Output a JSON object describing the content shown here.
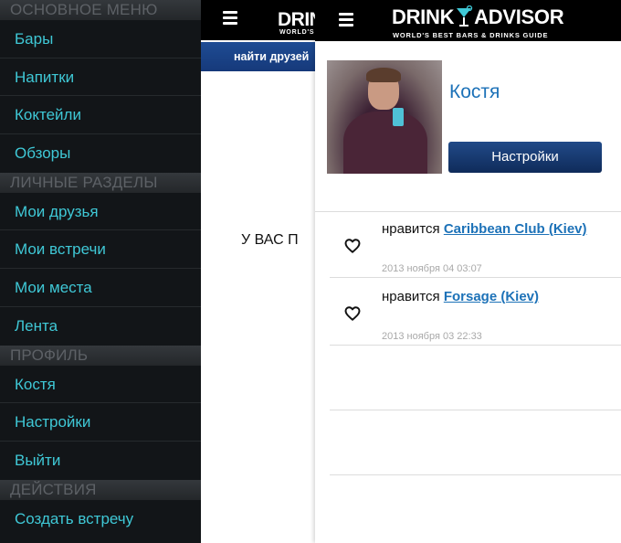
{
  "menu": {
    "sections": [
      {
        "header": "ОСНОВНОЕ МЕНЮ",
        "items": [
          "Бары",
          "Напитки",
          "Коктейли",
          "Обзоры"
        ]
      },
      {
        "header": "ЛИЧНЫЕ РАЗДЕЛЫ",
        "items": [
          "Мои друзья",
          "Мои встречи",
          "Мои места",
          "Лента"
        ]
      },
      {
        "header": "ПРОФИЛЬ",
        "items": [
          "Костя",
          "Настройки",
          "Выйти"
        ]
      },
      {
        "header": "ДЕЙСТВИЯ",
        "items": [
          "Создать встречу"
        ]
      }
    ]
  },
  "background_page": {
    "logo_text": "DRINK",
    "logo_sub": "WORLD'S",
    "tab_label": "найти друзей",
    "message": "У ВАС П"
  },
  "header": {
    "logo_left": "DRINK",
    "logo_right": "ADVISOR",
    "tagline": "WORLD'S BEST BARS & DRINKS GUIDE"
  },
  "profile": {
    "name": "Костя",
    "settings_label": "Настройки"
  },
  "feed": [
    {
      "verb": "нравится",
      "link": "Caribbean Club (Kiev)",
      "date": "2013 ноября 04 03:07"
    },
    {
      "verb": "нравится",
      "link": "Forsage (Kiev)",
      "date": "2013 ноября 03 22:33"
    }
  ],
  "colors": {
    "menu_text": "#3fc8d6",
    "link": "#1d72b8",
    "button": "#1a3f7a"
  }
}
